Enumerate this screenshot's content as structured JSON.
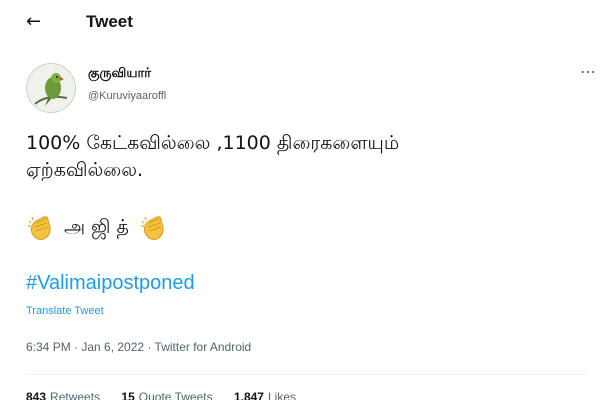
{
  "header": {
    "back_icon": "back-arrow-icon",
    "title": "Tweet"
  },
  "author": {
    "display_name": "குருவியார்",
    "handle": "@Kuruviyaaroffl",
    "avatar_icon": "parrot-avatar-icon"
  },
  "tweet": {
    "line1": "100% கேட்கவில்லை ,1100 திரைகளையும்",
    "line2": "ஏற்கவில்லை.",
    "emoji_text": "அ ஜி த்",
    "emoji_icon": "clapping-hands-icon",
    "hashtag": "#Valimaipostponed",
    "translate_label": "Translate Tweet",
    "timestamp": "6:34 PM · Jan 6, 2022 · Twitter for Android"
  },
  "stats": {
    "retweets_count": "843",
    "retweets_label": "Retweets",
    "quotes_count": "15",
    "quotes_label": "Quote Tweets",
    "likes_count": "1,847",
    "likes_label": "Likes"
  },
  "colors": {
    "link": "#1d9bf0",
    "secondary_text": "#536471",
    "primary_text": "#0f1419"
  }
}
